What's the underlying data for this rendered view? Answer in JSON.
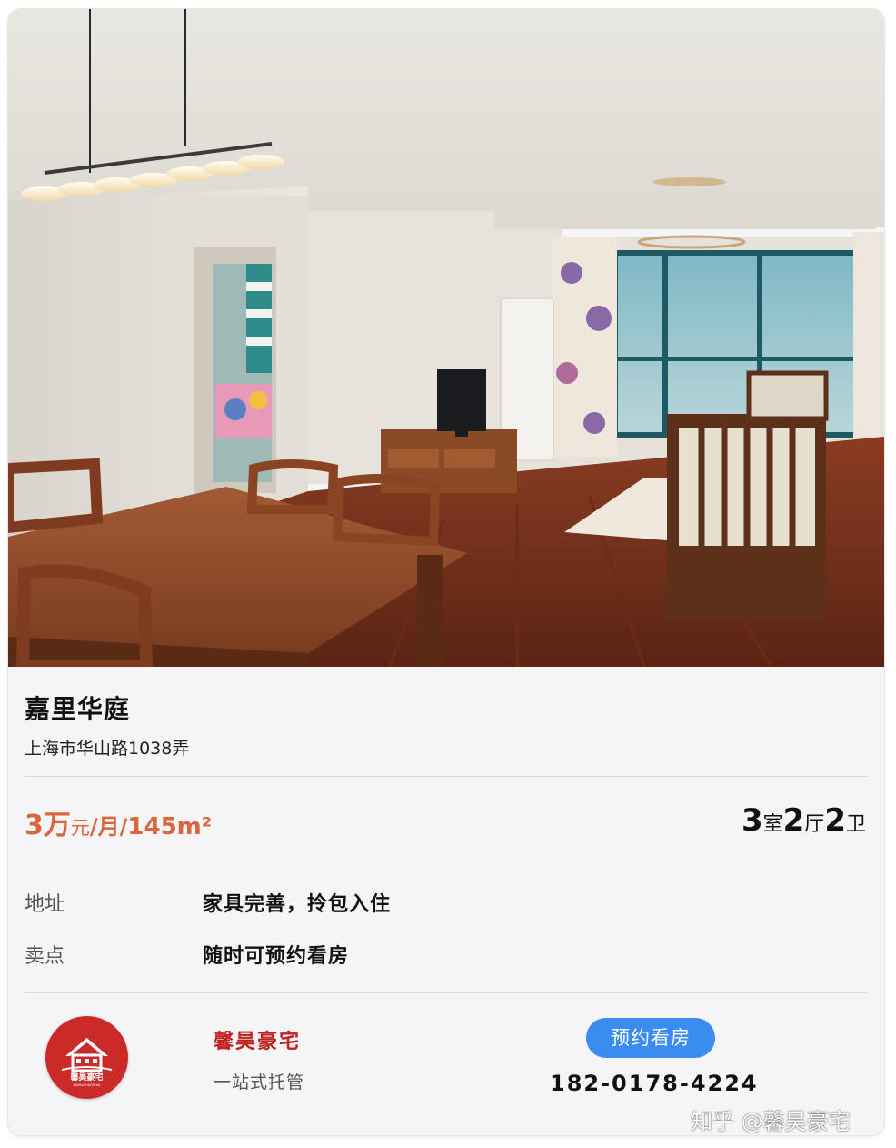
{
  "listing": {
    "name": "嘉里华庭",
    "address": "上海市华山路1038弄",
    "price_value": "3万",
    "price_unit": "元",
    "per_month": "/月/",
    "area": "145m²",
    "rooms": {
      "bed_n": "3",
      "bed_u": "室",
      "hall_n": "2",
      "hall_u": "厅",
      "bath_n": "2",
      "bath_u": "卫"
    }
  },
  "details": [
    {
      "key": "地址",
      "value": "家具完善，拎包入住"
    },
    {
      "key": "卖点",
      "value": "随时可预约看房"
    }
  ],
  "agency": {
    "logo_text": "馨昊豪宅",
    "logo_subtext": "XINHAOHAOZHAI",
    "name": "馨昊豪宅",
    "tagline": "一站式托管",
    "book_label": "预约看房",
    "phone": "182-0178-4224"
  },
  "watermark": "知乎 @馨昊豪宅",
  "colors": {
    "accent": "#d9663d",
    "brand_red": "#cc2a29",
    "button_blue": "#3a8cf0"
  }
}
